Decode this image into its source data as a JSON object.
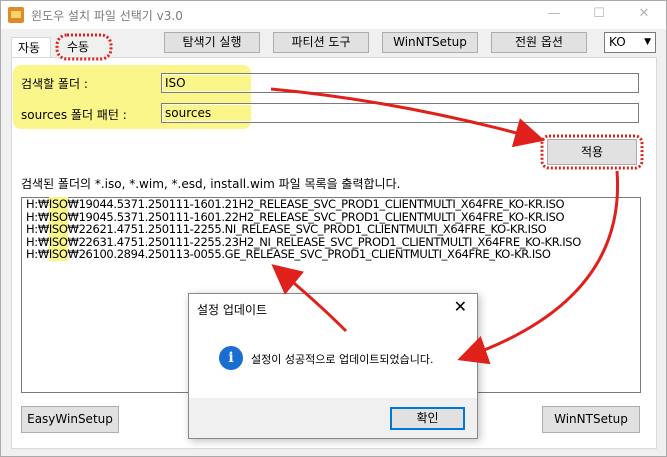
{
  "window": {
    "title": "윈도우 설치 파일 선택기 v3.0",
    "minimize_glyph": "—",
    "maximize_glyph": "☐",
    "close_glyph": "✕"
  },
  "tabs": [
    {
      "label": "자동"
    },
    {
      "label": "수동"
    }
  ],
  "toolbar": {
    "explorer_label": "탐색기 실행",
    "partition_label": "파티션 도구",
    "winntsetup_label": "WinNTSetup",
    "power_label": "전원 옵션",
    "language": "KO",
    "language_arrow": "▼"
  },
  "form": {
    "search_folder_label": "검색할 폴더 :",
    "search_folder_value": "ISO",
    "sources_pattern_label": "sources 폴더 패턴 :",
    "sources_pattern_value": "sources",
    "apply_label": "적용"
  },
  "results": {
    "description": "검색된 폴더의 *.iso, *.wim, *.esd, install.wim 파일 목록을 출력합니다.",
    "items": [
      {
        "prefix": "H:₩",
        "hl": "ISO",
        "rest": "₩19044.5371.250111-1601.21H2_RELEASE_SVC_PROD1_CLIENTMULTI_X64FRE_KO-KR.ISO"
      },
      {
        "prefix": "H:₩",
        "hl": "ISO",
        "rest": "₩19045.5371.250111-1601.22H2_RELEASE_SVC_PROD1_CLIENTMULTI_X64FRE_KO-KR.ISO"
      },
      {
        "prefix": "H:₩",
        "hl": "ISO",
        "rest": "₩22621.4751.250111-2255.NI_RELEASE_SVC_PROD1_CLIENTMULTI_X64FRE_KO-KR.ISO"
      },
      {
        "prefix": "H:₩",
        "hl": "ISO",
        "rest": "₩22631.4751.250111-2255.23H2_NI_RELEASE_SVC_PROD1_CLIENTMULTI_X64FRE_KO-KR.ISO"
      },
      {
        "prefix": "H:₩",
        "hl": "ISO",
        "rest": "₩26100.2894.250113-0055.GE_RELEASE_SVC_PROD1_CLIENTMULTI_X64FRE_KO-KR.ISO"
      }
    ]
  },
  "bottom": {
    "easywinsetup_label": "EasyWinSetup",
    "winntsetup_label": "WinNTSetup"
  },
  "dialog": {
    "title": "설정 업데이트",
    "close_glyph": "✕",
    "icon_glyph": "i",
    "message": "설정이 성공적으로 업데이트되었습니다.",
    "ok_label": "확인"
  },
  "colors": {
    "highlight": "#fbf68a",
    "annotation_red": "#e0201a",
    "info_blue": "#1b6ed1"
  }
}
